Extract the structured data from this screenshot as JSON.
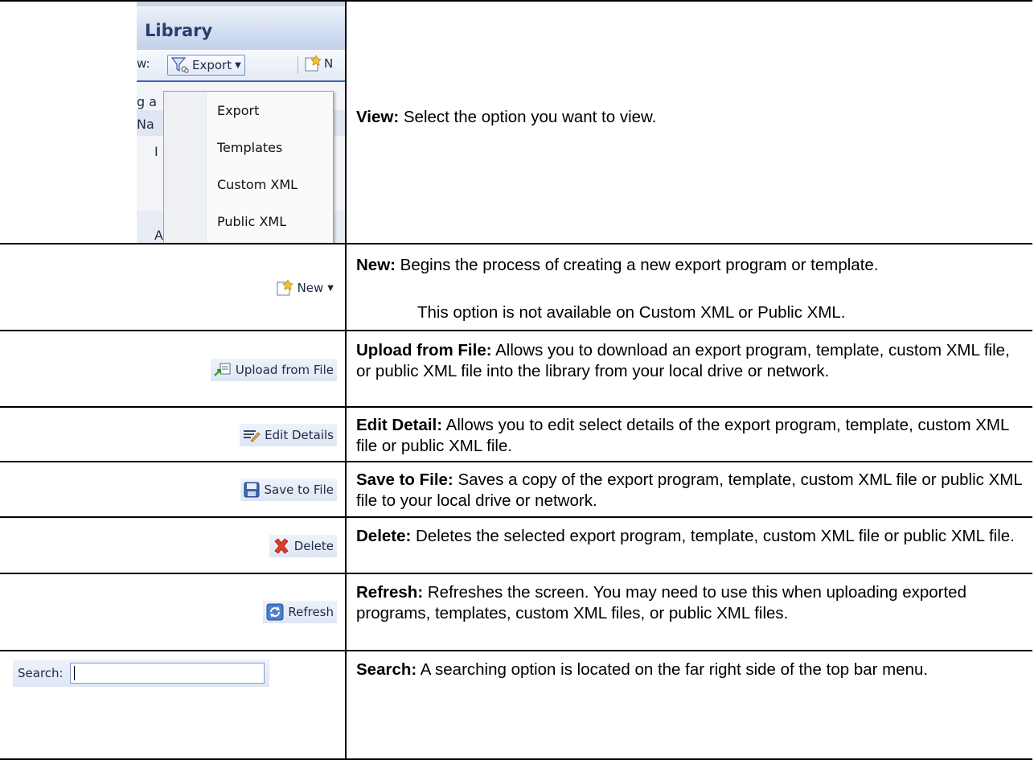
{
  "library_panel": {
    "title": "Library",
    "view_label_fragment": "w:",
    "export_button": "Export",
    "new_button_fragment": "N",
    "row_fragments": [
      "g a",
      "Na",
      "I",
      "A"
    ],
    "dropdown_items": [
      "Export",
      "Templates",
      "Custom XML",
      "Public XML"
    ]
  },
  "rows": [
    {
      "term": "View:",
      "text": " Select the option you want to view."
    },
    {
      "button": "New",
      "term": "New:",
      "text": " Begins the process of creating a new export program or template.",
      "note": "This option is not available on Custom XML or Public XML."
    },
    {
      "button": "Upload from File",
      "term": "Upload from File:",
      "text": " Allows you to download an export program, template, custom XML file, or public XML file into the library from your local drive or network."
    },
    {
      "button": "Edit Details",
      "term": "Edit Detail:",
      "text": "  Allows you to edit select details of the export program, template, custom XML file or public XML file."
    },
    {
      "button": "Save to File",
      "term": "Save to File:",
      "text": " Saves a copy of the export program, template, custom XML file or public XML file to your local drive or network."
    },
    {
      "button": "Delete",
      "term": "Delete:",
      "text": "  Deletes the selected export program, template, custom XML file or public XML file."
    },
    {
      "button": "Refresh",
      "term": "Refresh:",
      "text": " Refreshes the screen. You may need to use this when uploading exported programs, templates, custom XML files, or public XML files."
    },
    {
      "button": "Search:",
      "term": "Search:",
      "text": " A searching option is located on the far right side of the top bar menu."
    }
  ]
}
